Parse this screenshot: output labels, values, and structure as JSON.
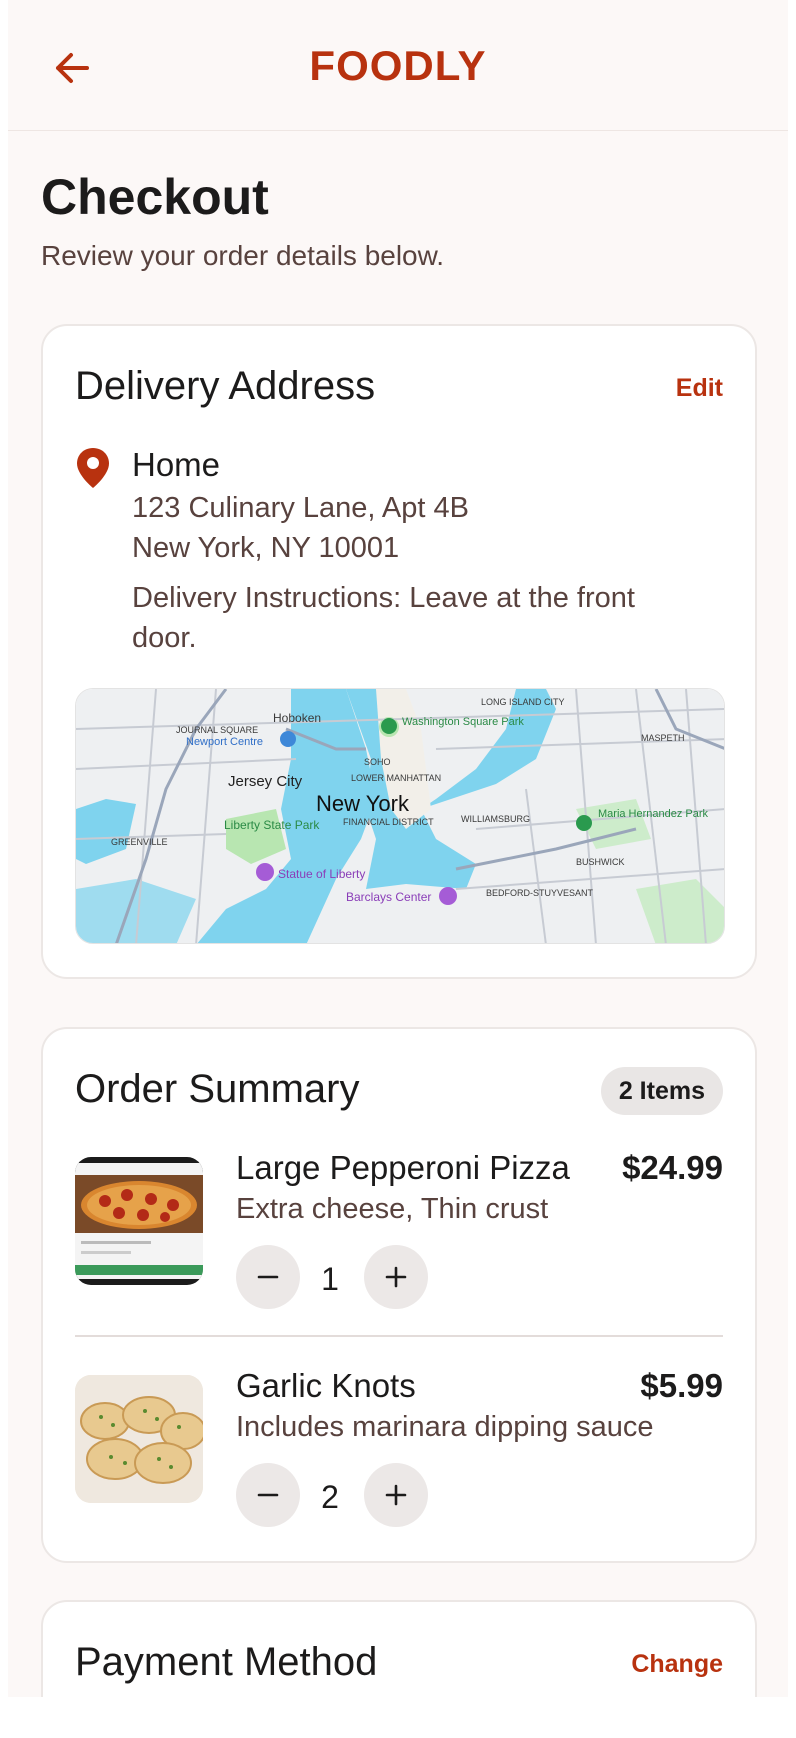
{
  "header": {
    "brand": "FOODLY",
    "back_icon": "arrow-left-icon"
  },
  "page": {
    "title": "Checkout",
    "subtitle": "Review your order details below."
  },
  "delivery": {
    "title": "Delivery Address",
    "edit_label": "Edit",
    "label": "Home",
    "line1": "123 Culinary Lane, Apt 4B",
    "line2": "New York, NY 10001",
    "instructions": "Delivery Instructions: Leave at the front door.",
    "map": {
      "labels": {
        "hoboken": "Hoboken",
        "journal_square": "JOURNAL SQUARE",
        "newport": "Newport Centre",
        "jersey_city": "Jersey City",
        "new_york": "New York",
        "washington_sq": "Washington Square Park",
        "soho": "SOHO",
        "lower_manhattan": "LOWER MANHATTAN",
        "financial": "FINANCIAL DISTRICT",
        "liberty_park": "Liberty State Park",
        "statue": "Statue of Liberty",
        "barclays": "Barclays Center",
        "williamsburg": "WILLIAMSBURG",
        "bushwick": "BUSHWICK",
        "bedford": "BEDFORD-STUYVESANT",
        "greenville": "GREENVILLE",
        "long_island": "LONG ISLAND CITY",
        "maspeth": "MASPETH",
        "maria_park": "Maria Hernandez Park"
      }
    }
  },
  "order": {
    "title": "Order Summary",
    "count_badge": "2 Items",
    "items": [
      {
        "name": "Large Pepperoni Pizza",
        "price": "$24.99",
        "desc": "Extra cheese, Thin crust",
        "qty": "1"
      },
      {
        "name": "Garlic Knots",
        "price": "$5.99",
        "desc": "Includes marinara dipping sauce",
        "qty": "2"
      }
    ]
  },
  "payment": {
    "title": "Payment Method",
    "change_label": "Change"
  },
  "colors": {
    "brand": "#b8320f",
    "background": "#fcf8f7",
    "water": "#7fd3ee",
    "park": "#b8e6b1"
  }
}
